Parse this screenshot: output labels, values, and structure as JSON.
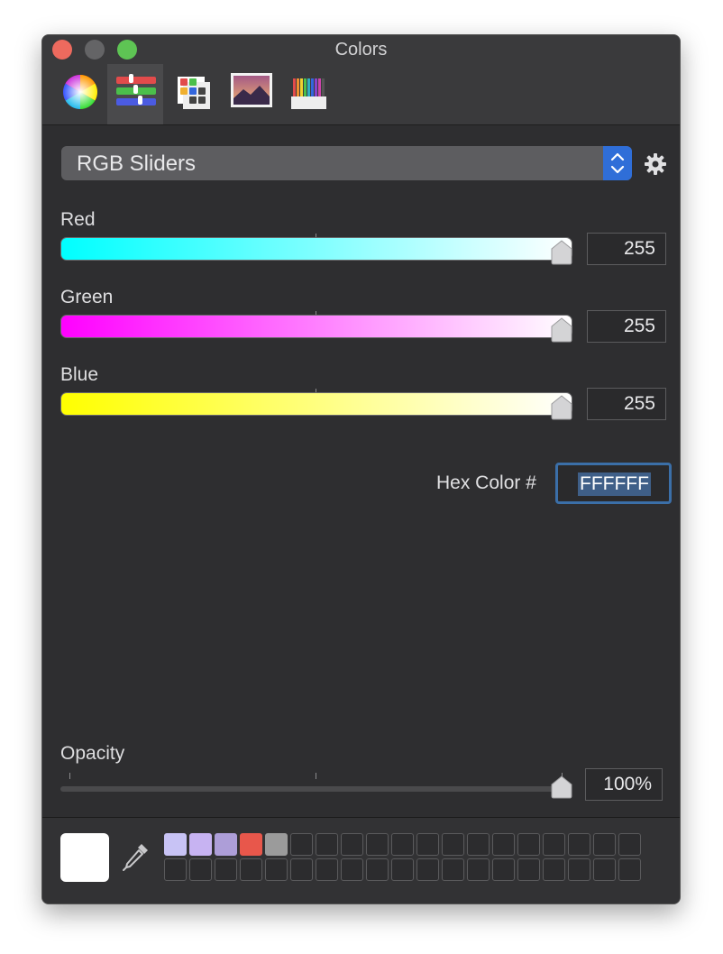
{
  "window": {
    "title": "Colors"
  },
  "toolbar": {
    "tabs": [
      {
        "name": "color-wheel"
      },
      {
        "name": "color-sliders",
        "active": true
      },
      {
        "name": "color-palettes"
      },
      {
        "name": "image-palettes"
      },
      {
        "name": "pencils"
      }
    ]
  },
  "mode": {
    "selected": "RGB Sliders"
  },
  "sliders": [
    {
      "label": "Red",
      "value": "255",
      "fraction": 1.0
    },
    {
      "label": "Green",
      "value": "255",
      "fraction": 1.0
    },
    {
      "label": "Blue",
      "value": "255",
      "fraction": 1.0
    }
  ],
  "hex": {
    "label": "Hex Color #",
    "value": "FFFFFF"
  },
  "opacity": {
    "label": "Opacity",
    "value": "100%",
    "fraction": 1.0
  },
  "current_color": "#FFFFFF",
  "swatches": {
    "filled": [
      "#c8c3f5",
      "#c7b3f2",
      "#ad9ed8",
      "#e8574b",
      "#9b9b9b"
    ],
    "columns": 19,
    "rows": 2
  },
  "colors": {
    "accent": "#2F6ED8",
    "window_bg": "#2E2E30"
  }
}
